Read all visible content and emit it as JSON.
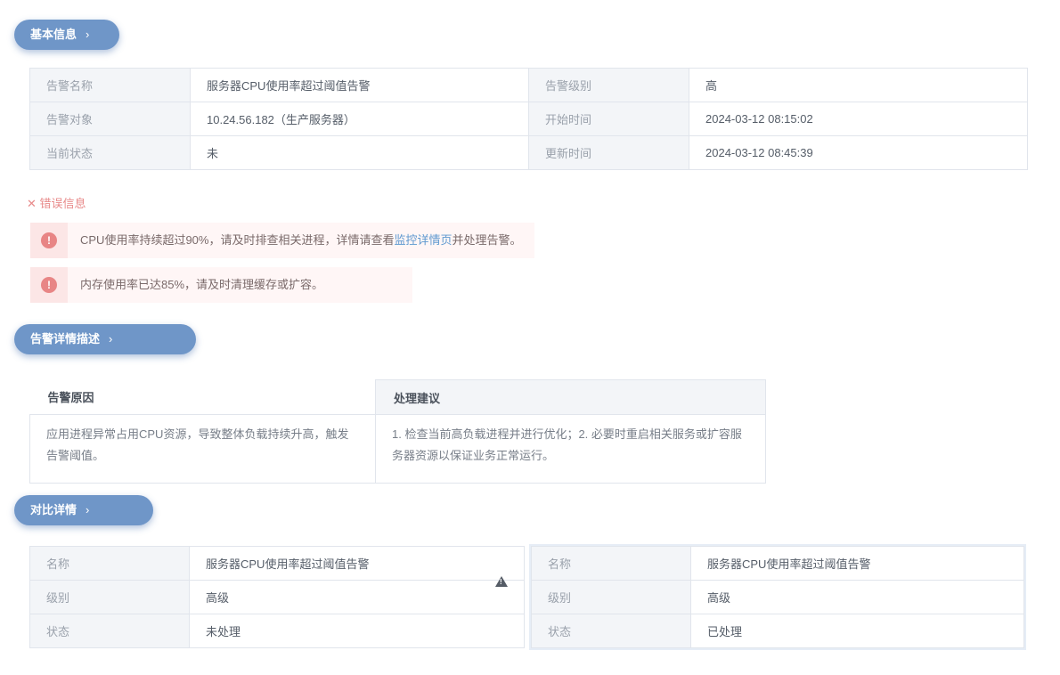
{
  "sections": {
    "basic": {
      "label": "基本信息"
    },
    "desc": {
      "label": "告警详情描述"
    },
    "compare": {
      "label": "对比详情"
    }
  },
  "basic_info": {
    "rows": [
      {
        "k1": "告警名称",
        "v1": "服务器CPU使用率超过阈值告警",
        "k2": "告警级别",
        "v2": "高"
      },
      {
        "k1": "告警对象",
        "v1": "10.24.56.182（生产服务器）",
        "k2": "开始时间",
        "v2": "2024-03-12 08:15:02"
      },
      {
        "k1": "当前状态",
        "v1": "未",
        "k2": "更新时间",
        "v2": "2024-03-12 08:45:39"
      }
    ]
  },
  "errors": {
    "header": "错误信息",
    "items": [
      {
        "text": "CPU使用率持续超过90%，请及时排查相关进程，详情请查看",
        "link": "监控详情页",
        "suffix": "并处理告警。"
      },
      {
        "text": "内存使用率已达85%，请及时清理缓存或扩容。"
      }
    ]
  },
  "description": {
    "headers": [
      "告警原因",
      "处理建议"
    ],
    "cells": [
      "应用进程异常占用CPU资源，导致整体负载持续升高，触发告警阈值。",
      "1. 检查当前高负载进程并进行优化；2. 必要时重启相关服务或扩容服务器资源以保证业务正常运行。"
    ]
  },
  "compare_left": {
    "rows": [
      {
        "k": "名称",
        "v": "服务器CPU使用率超过阈值告警"
      },
      {
        "k": "级别",
        "v": "高级"
      },
      {
        "k": "状态",
        "v": "未处理"
      }
    ]
  },
  "compare_right": {
    "rows": [
      {
        "k": "名称",
        "v": "服务器CPU使用率超过阈值告警"
      },
      {
        "k": "级别",
        "v": "高级"
      },
      {
        "k": "状态",
        "v": "已处理"
      }
    ]
  },
  "icons": {
    "warning": "warning-icon",
    "error": "error-icon",
    "chevron": "chevron-right-icon"
  },
  "colors": {
    "accent": "#6f96c8",
    "error": "#e88585",
    "link": "#5f99d0"
  }
}
